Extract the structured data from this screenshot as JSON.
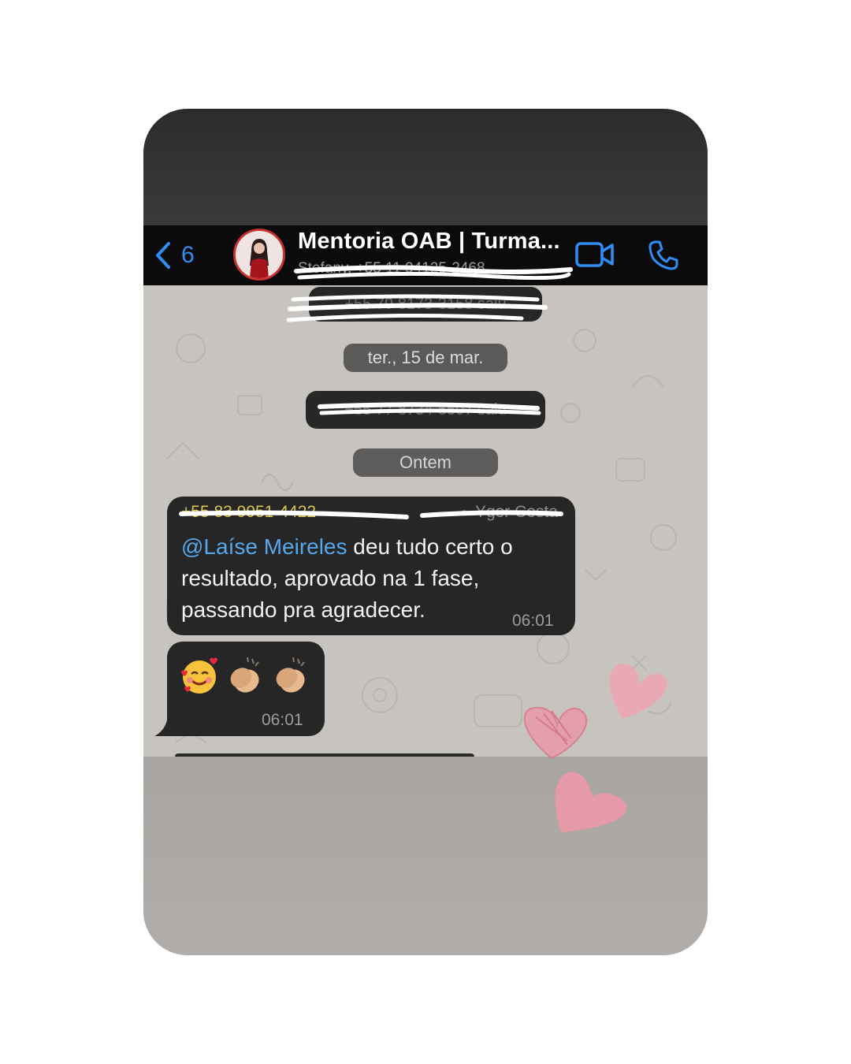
{
  "header": {
    "back_count": "6",
    "group_title": "Mentoria OAB | Turma...",
    "subtitle_obscured": "Stefany, +55 11 94125-2468,"
  },
  "chat": {
    "system_obscured_1": "+55 79 8173-3158 saiu",
    "date_pill_1": "ter., 15 de mar.",
    "system_obscured_2": "+55 77 8734-5507 saiu",
    "date_pill_2": "Ontem",
    "message1": {
      "sender_phone_obscured": "+55 83 9951-4422",
      "sender_name_obscured": "~ Ygor Costa",
      "mention": "@Laíse Meireles",
      "text": " deu tudo certo o resultado, aprovado na 1 fase, passando pra agradecer.",
      "time": "06:01"
    },
    "message2": {
      "emojis": [
        "smiling-face-with-hearts",
        "clapping-hands",
        "clapping-hands"
      ],
      "time": "06:01"
    }
  },
  "colors": {
    "accent_blue": "#2f8ef4",
    "mention_blue": "#56a7ee",
    "sender_yellow": "#d9c64b",
    "heart_pink": "#e89aa8"
  },
  "icons": [
    "chevron-left-icon",
    "video-camera-icon",
    "phone-icon",
    "heart-doodle-icon"
  ]
}
